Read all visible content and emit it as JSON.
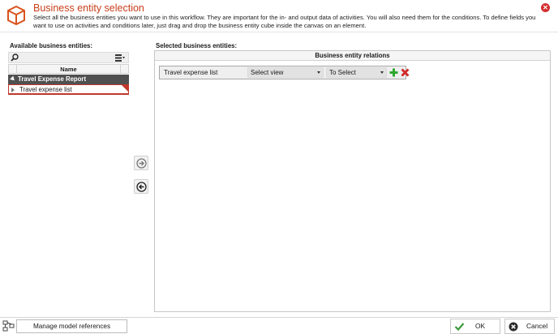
{
  "dialog": {
    "title": "Business entity selection",
    "description": "Select all the business entities you want to use in this workflow. They are important for the in- and output data of activities. You will also need them for the conditions. To define fields you want to use on activities and conditions later, just drag and drop the business entity cube inside the canvas on an element.",
    "accent_color": "#c8401c"
  },
  "available": {
    "label": "Available business entities:",
    "column_name": "Name",
    "groups": [
      {
        "label": "Travel Expense Report",
        "items": [
          {
            "label": "Travel expense list",
            "selected": true
          }
        ]
      }
    ]
  },
  "selected": {
    "label": "Selected business entities:",
    "relations_header": "Business entity relations",
    "rows": [
      {
        "name": "Travel expense list",
        "view": "Select view",
        "target": "To Select"
      }
    ]
  },
  "footer": {
    "manage_label": "Manage model references",
    "ok_label": "OK",
    "cancel_label": "Cancel"
  },
  "icons": {
    "header": "cube-icon",
    "close": "close-circle-icon",
    "search": "search-icon",
    "filter": "filter-icon",
    "move_right": "arrow-right-circle-icon",
    "move_left": "arrow-left-circle-icon",
    "add": "plus-icon",
    "remove": "x-icon",
    "manage": "model-references-icon",
    "ok": "checkmark-icon",
    "cancel": "cancel-circle-icon"
  }
}
